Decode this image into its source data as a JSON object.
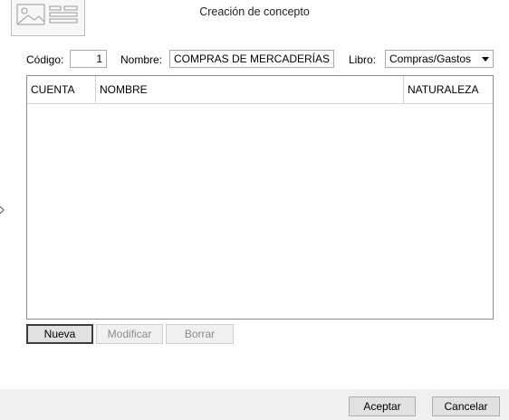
{
  "dialog": {
    "title": "Creación de concepto"
  },
  "form": {
    "codigo_label": "Código:",
    "codigo_value": "1",
    "nombre_label": "Nombre:",
    "nombre_value": "COMPRAS DE MERCADERÍAS",
    "libro_label": "Libro:",
    "libro_value": "Compras/Gastos"
  },
  "table": {
    "columns": [
      "CUENTA",
      "NOMBRE",
      "NATURALEZA"
    ],
    "rows": []
  },
  "row_buttons": {
    "nueva": "Nueva",
    "modificar": "Modificar",
    "borrar": "Borrar"
  },
  "footer": {
    "aceptar": "Aceptar",
    "cancelar": "Cancelar"
  },
  "icons": {
    "header": "document-image-icon",
    "dropdown": "chevron-down-icon",
    "side": "chevron-right-icon"
  }
}
